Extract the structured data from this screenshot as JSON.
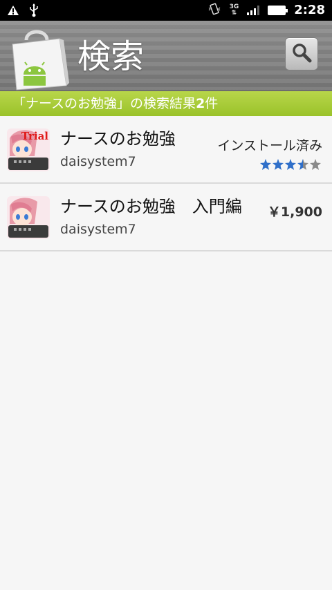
{
  "status_bar": {
    "time": "2:28",
    "network": "3G",
    "icons": [
      "warning-icon",
      "usb-icon",
      "vibrate-icon",
      "signal-icon",
      "battery-icon"
    ]
  },
  "header": {
    "title": "検索",
    "app_icon": "android-market-bag-icon",
    "search_button_icon": "search-icon"
  },
  "results_header": {
    "prefix": "「ナースのお勉強」の検索結果",
    "count": "2",
    "suffix": "件"
  },
  "results": [
    {
      "name": "ナースのお勉強",
      "developer": "daisystem7",
      "status": "インストール済み",
      "icon_badge": "Trial",
      "rating": 3.5
    },
    {
      "name": "ナースのお勉強　入門編",
      "developer": "daisystem7",
      "price": "￥1,900"
    }
  ],
  "colors": {
    "results_bar": "#a6c934",
    "star": "#2f6fc9",
    "star_empty": "#8a8a8a"
  }
}
